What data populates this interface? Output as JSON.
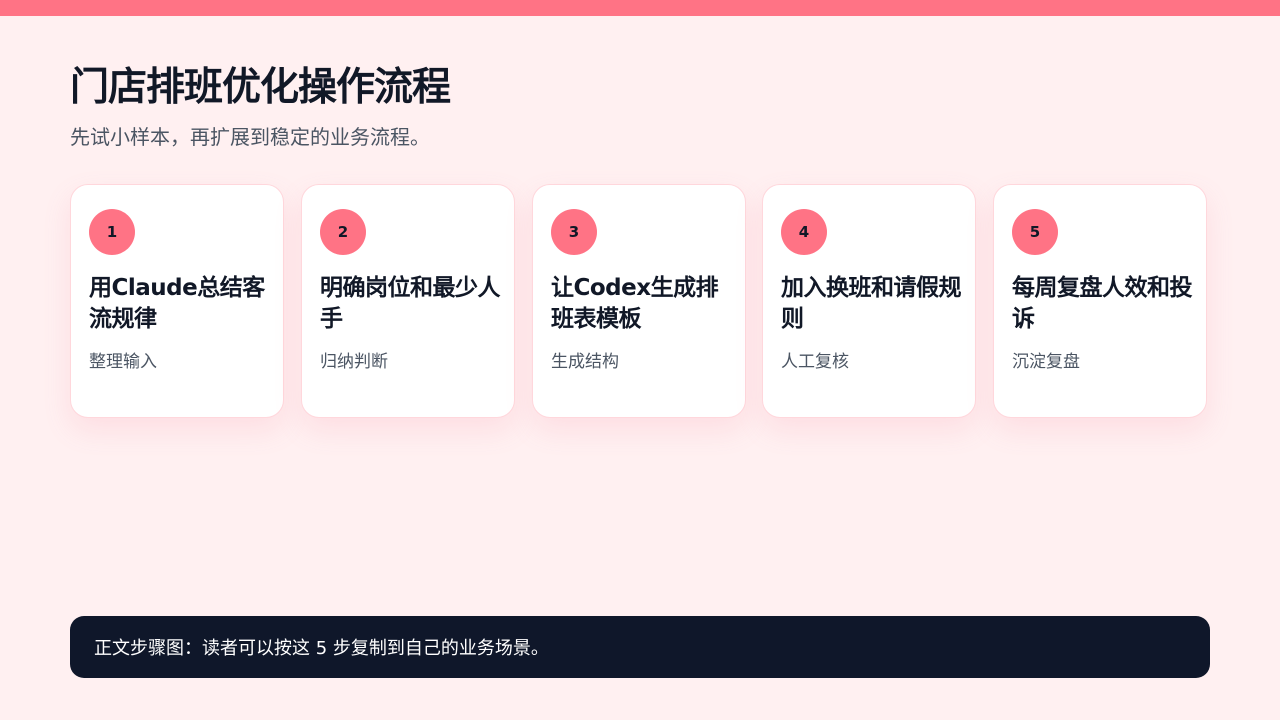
{
  "header": {
    "title": "门店排班优化操作流程",
    "subtitle": "先试小样本，再扩展到稳定的业务流程。"
  },
  "steps": [
    {
      "number": "1",
      "title": "用Claude总结客流规律",
      "desc": "整理输入"
    },
    {
      "number": "2",
      "title": "明确岗位和最少人手",
      "desc": "归纳判断"
    },
    {
      "number": "3",
      "title": "让Codex生成排班表模板",
      "desc": "生成结构"
    },
    {
      "number": "4",
      "title": "加入换班和请假规则",
      "desc": "人工复核"
    },
    {
      "number": "5",
      "title": "每周复盘人效和投诉",
      "desc": "沉淀复盘"
    }
  ],
  "footer": {
    "note": "正文步骤图：读者可以按这 5 步复制到自己的业务场景。"
  },
  "colors": {
    "accent": "#ff7385",
    "background": "#fff0f1",
    "dark": "#0f172a"
  }
}
